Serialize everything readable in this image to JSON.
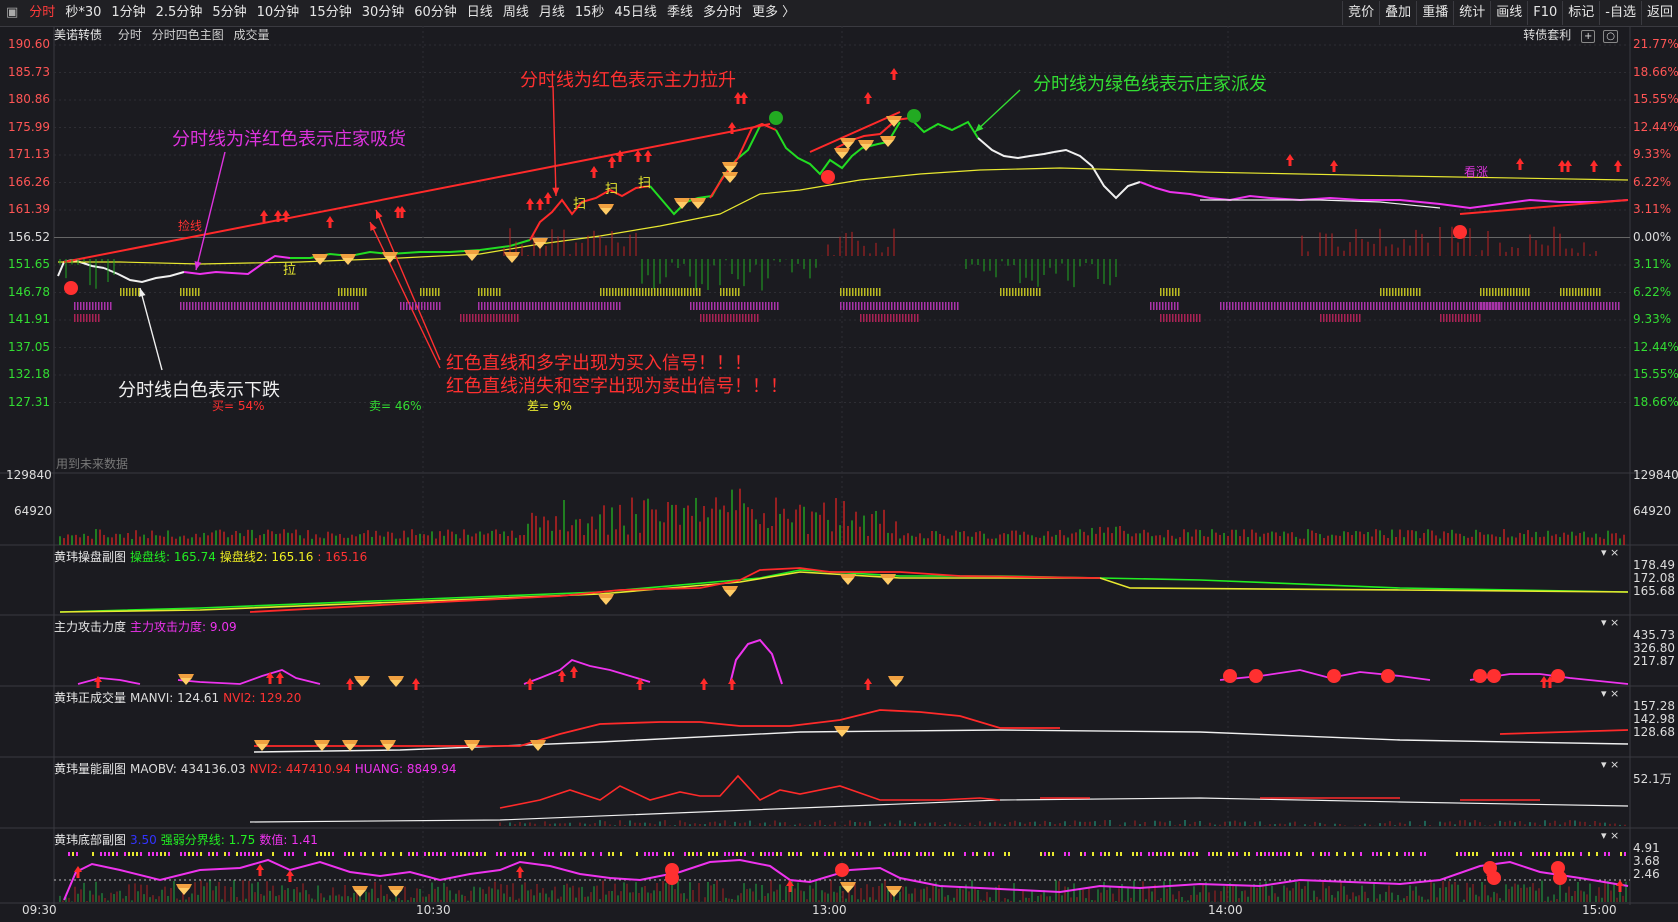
{
  "toolbar": {
    "tabs": [
      "分时",
      "秒*30",
      "1分钟",
      "2.5分钟",
      "5分钟",
      "10分钟",
      "15分钟",
      "30分钟",
      "60分钟",
      "日线",
      "周线",
      "月线",
      "15秒",
      "45日线",
      "季线",
      "多分时",
      "更多 〉"
    ],
    "right_buttons": [
      "竞价",
      "叠加",
      "重播",
      "统计",
      "画线",
      "F10",
      "标记",
      "-自选",
      "返回"
    ]
  },
  "header": {
    "stock_name": "美诺转债",
    "items": [
      "分时",
      "分时四色主图",
      "成交量"
    ],
    "right_label": "转债套利"
  },
  "price_axis": [
    "190.60",
    "185.73",
    "180.86",
    "175.99",
    "171.13",
    "166.26",
    "161.39",
    "156.52",
    "151.65",
    "146.78",
    "141.91",
    "137.05",
    "132.18",
    "127.31"
  ],
  "pct_axis": [
    "21.77%",
    "18.66%",
    "15.55%",
    "12.44%",
    "9.33%",
    "6.22%",
    "3.11%",
    "0.00%",
    "3.11%",
    "6.22%",
    "9.33%",
    "12.44%",
    "15.55%",
    "18.66%"
  ],
  "volume_axis": [
    "129840",
    "64920"
  ],
  "volume_axis_right": [
    "129840",
    "64920"
  ],
  "annotations": {
    "a1": "分时线为红色表示主力拉升",
    "a2": "分时线为绿色线表示庄家派发",
    "a3": "分时线为洋红色表示庄家吸货",
    "a4": "红色直线和多字出现为买入信号！！！",
    "a5": "红色直线消失和空字出现为卖出信号！！！",
    "a6": "分时线白色表示下跌",
    "future": "用到未来数据",
    "jx": "捡线",
    "la": "拉",
    "sao": "扫",
    "kzz": "看涨",
    "duo": "多",
    "kong": "空"
  },
  "stats": {
    "buy": "买= 54%",
    "sell": "卖= 46%",
    "diff": "差= 9%"
  },
  "panels": [
    {
      "name": "黄玮操盘副图",
      "parts": [
        {
          "t": "操盘线: 165.74",
          "c": "#22ee22"
        },
        {
          "t": "操盘线2: 165.16",
          "c": "#eeee22"
        },
        {
          "t": ": 165.16",
          "c": "#ff3333"
        }
      ],
      "axis": [
        "178.49",
        "172.08",
        "165.68"
      ]
    },
    {
      "name": "主力攻击力度",
      "parts": [
        {
          "t": "主力攻击力度: 9.09",
          "c": "#ee33ee"
        }
      ],
      "axis": [
        "435.73",
        "326.80",
        "217.87"
      ]
    },
    {
      "name": "黄玮正成交量",
      "parts": [
        {
          "t": "MANVI: 124.61",
          "c": "#dddddd"
        },
        {
          "t": "NVI2: 129.20",
          "c": "#ff3333"
        }
      ],
      "axis": [
        "157.28",
        "142.98",
        "128.68"
      ]
    },
    {
      "name": "黄玮量能副图",
      "parts": [
        {
          "t": "MAOBV: 434136.03",
          "c": "#dddddd"
        },
        {
          "t": "NVI2: 447410.94",
          "c": "#ff3333"
        },
        {
          "t": "HUANG: 8849.94",
          "c": "#ee33ee"
        }
      ],
      "axis": [
        "52.1万"
      ]
    },
    {
      "name": "黄玮底部副图",
      "parts": [
        {
          "t": "3.50",
          "c": "#3333ff"
        },
        {
          "t": "强弱分界线: 1.75",
          "c": "#22ee22"
        },
        {
          "t": "数值: 1.41",
          "c": "#ee33ee"
        }
      ],
      "axis": [
        "4.91",
        "3.68",
        "2.46"
      ]
    }
  ],
  "time_axis": [
    "09:30",
    "10:30",
    "13:00",
    "14:00",
    "15:00"
  ],
  "colors": {
    "up": "#ff2a2a",
    "down": "#22dd22",
    "magenta": "#ee33ee",
    "yellow": "#e8e830",
    "white": "#f0f0f0",
    "bg": "#1b1b20"
  }
}
